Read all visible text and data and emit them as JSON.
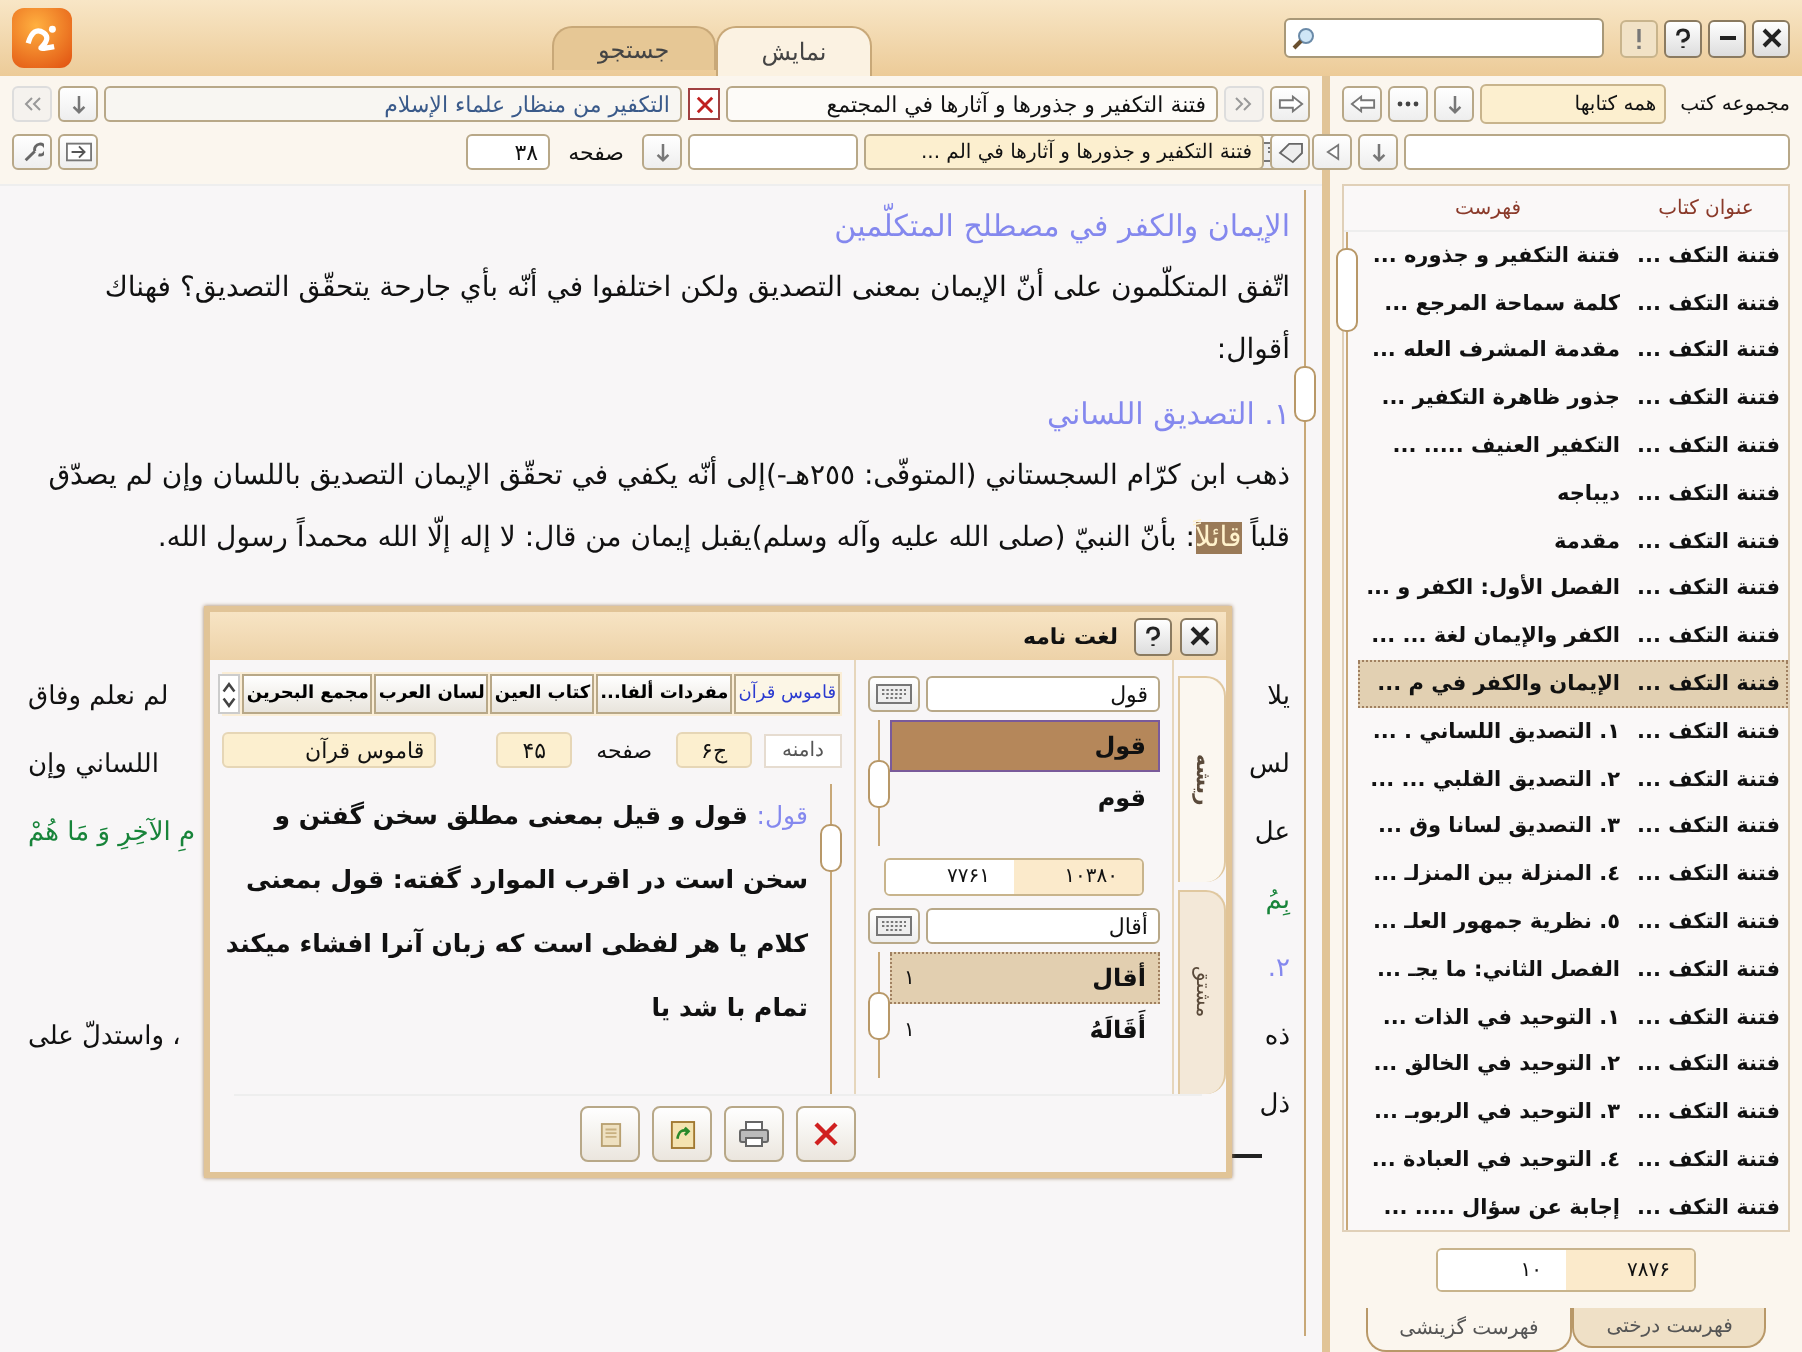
{
  "window": {
    "tabs": [
      {
        "label": "نمایش",
        "selected": true
      },
      {
        "label": "جستجو",
        "selected": false
      }
    ]
  },
  "toolbar": {
    "book_title": "فتنة التكفير و جذورها و آثارها في المجتمع",
    "second_book": "التكفير من منظار علماء الإسلام",
    "chapter": "فتنة التكفير و جذورها و آثارها في الم ...",
    "page_label": "صفحه",
    "page": "۳۸"
  },
  "content": {
    "blocks": [
      {
        "kind": "heading",
        "segments": [
          {
            "text": "الإيمان والكفر في مصطلح المتكلّمين",
            "highlighted": false
          }
        ]
      },
      {
        "kind": "paragraph",
        "segments": [
          {
            "text": "اتّفق المتكلّمون على أنّ الإيمان بمعنى التصديق ولكن اختلفوا في أنّه بأي جارحة يتحقّق التصديق؟ فهناك أقوال:",
            "highlighted": false
          }
        ]
      },
      {
        "kind": "heading",
        "segments": [
          {
            "text": "١. التصديق اللساني",
            "highlighted": false
          }
        ]
      },
      {
        "kind": "paragraph",
        "segments": [
          {
            "text": "ذهب ابن كرّام السجستاني (المتوفّى: ٢٥٥هـ-)إلى أنّه يكفي في تحقّق الإيمان التصديق باللسان وإن لم يصدّق قلباً ",
            "highlighted": false
          },
          {
            "text": "قائلاً",
            "highlighted": true
          },
          {
            "text": ": بأنّ النبيّ (صلى الله عليه وآله وسلم)يقبل إيمان من قال: لا إله إلّا الله محمداً رسول الله.",
            "highlighted": false
          }
        ]
      }
    ],
    "covered_lines": [
      {
        "right": {
          "text": "يلا",
          "kind": "text"
        },
        "left": {
          "text": "لم نعلم وفاق",
          "kind": "text"
        }
      },
      {
        "right": {
          "text": "لس",
          "kind": "text"
        },
        "left": {
          "text": "اللساني وإن",
          "kind": "text"
        }
      },
      {
        "right": {
          "text": "عل",
          "kind": "text"
        },
        "left": {
          "text": "مِ الآخِرِ وَ مَا هُمْ",
          "kind": "verse"
        }
      },
      {
        "right": {
          "text": "بِمُ",
          "kind": "verse"
        }
      },
      {
        "right": {
          "text": "٢.",
          "kind": "heading"
        }
      },
      {
        "right": {
          "text": "ذه",
          "kind": "text"
        },
        "left": {
          "text": "، واستدلّ على",
          "kind": "text"
        }
      },
      {
        "right": {
          "text": "ذل",
          "kind": "text"
        }
      }
    ]
  },
  "sidebar": {
    "collection_label": "مجموعه کتب",
    "collection": "همه کتابها",
    "columns": [
      "عنوان کتاب",
      "فهرست"
    ],
    "rows": [
      {
        "book": "فتنة التكف ...",
        "title": "فتنة التكفير و جذوره ...",
        "selected": false
      },
      {
        "book": "فتنة التكف ...",
        "title": "كلمة سماحة المرجع ...",
        "selected": false
      },
      {
        "book": "فتنة التكف ...",
        "title": "مقدمة المشرف العله ...",
        "selected": false
      },
      {
        "book": "فتنة التكف ...",
        "title": "جذور ظاهرة التكفير ...",
        "selected": false
      },
      {
        "book": "فتنة التكف ...",
        "title": "التكفير العنيف ..... ...",
        "selected": false
      },
      {
        "book": "فتنة التكف ...",
        "title": "ديباجه",
        "selected": false
      },
      {
        "book": "فتنة التكف ...",
        "title": "مقدمة",
        "selected": false
      },
      {
        "book": "فتنة التكف ...",
        "title": "الفصل الأول: الكفر و ...",
        "selected": false
      },
      {
        "book": "فتنة التكف ...",
        "title": "الكفر والإيمان لغة ... ...",
        "selected": false
      },
      {
        "book": "فتنة التكف ...",
        "title": "الإيمان والكفر في م ...",
        "selected": true
      },
      {
        "book": "فتنة التكف ...",
        "title": "١. التصديق اللساني . ...",
        "selected": false
      },
      {
        "book": "فتنة التكف ...",
        "title": "٢. التصديق القلبي ... ...",
        "selected": false
      },
      {
        "book": "فتنة التكف ...",
        "title": "٣. التصديق لسانا وق ...",
        "selected": false
      },
      {
        "book": "فتنة التكف ...",
        "title": "٤. المنزلة بين المنزلـ ...",
        "selected": false
      },
      {
        "book": "فتنة التكف ...",
        "title": "٥. نظرية جمهور العلـ ...",
        "selected": false
      },
      {
        "book": "فتنة التكف ...",
        "title": "الفصل الثاني: ما يجـ ...",
        "selected": false
      },
      {
        "book": "فتنة التكف ...",
        "title": "١. التوحيد في الذات ...",
        "selected": false
      },
      {
        "book": "فتنة التكف ...",
        "title": "٢. التوحيد في الخالق ...",
        "selected": false
      },
      {
        "book": "فتنة التكف ...",
        "title": "٣. التوحيد في الربوبـ ...",
        "selected": false
      },
      {
        "book": "فتنة التكف ...",
        "title": "٤. التوحيد في العبادة ...",
        "selected": false
      },
      {
        "book": "فتنة التكف ...",
        "title": "إجابة عن سؤال ..... ...",
        "selected": false
      }
    ],
    "pager": {
      "total": "۷۸۷۶",
      "page": "۱۰"
    },
    "bottom_tabs": [
      {
        "label": "فهرست درختی",
        "selected": false
      },
      {
        "label": "فهرست گزینشی",
        "selected": true
      }
    ]
  },
  "dictionary": {
    "title": "لغت نامه",
    "side_tabs": [
      {
        "label": "ریشه",
        "selected": true
      },
      {
        "label": "مشتق",
        "selected": false
      }
    ],
    "root_search": "قول",
    "roots": [
      {
        "label": "قول",
        "selected": true
      },
      {
        "label": "قوم",
        "selected": false
      }
    ],
    "counter": {
      "first": "۱۰۳۸۰",
      "second": "۷۷۶۱"
    },
    "derived_search": "أقال",
    "derived": [
      {
        "label": "أقال",
        "count": "۱",
        "selected": true
      },
      {
        "label": "أَقَالَهُ",
        "count": "۱",
        "selected": false
      }
    ],
    "sources": [
      {
        "label": "قاموس قرآن",
        "selected": true
      },
      {
        "label": "مفردات ألفا...",
        "selected": false
      },
      {
        "label": "كتاب العين",
        "selected": false
      },
      {
        "label": "لسان العرب",
        "selected": false
      },
      {
        "label": "مجمع البحرين",
        "selected": false
      }
    ],
    "scope_label": "دامنه",
    "volume": "ج۶",
    "page_label": "صفحه",
    "page": "۴۵",
    "source": "قاموس قرآن",
    "entry": {
      "term": "قول:",
      "text": " قول و قيل بمعنى مطلق سخن گفتن و سخن است در اقرب الموارد گفته: قول بمعنى كلام يا هر لفظى است كه زبان آنرا افشاء ميكند تمام با شد يا"
    }
  }
}
